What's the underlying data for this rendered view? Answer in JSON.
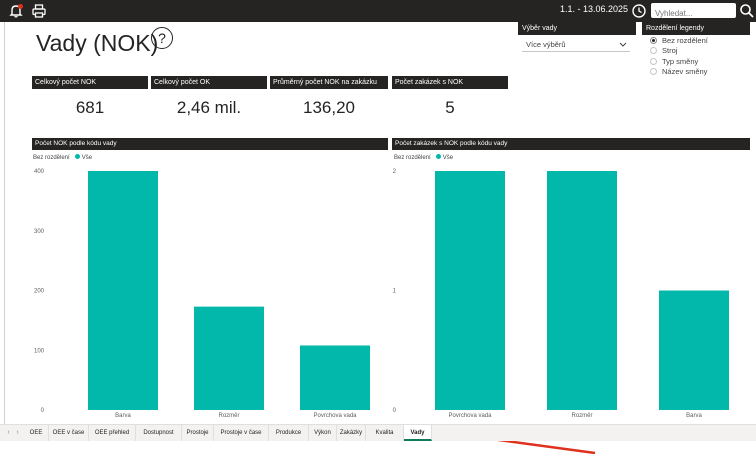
{
  "topbar": {
    "date_range": "1.1. - 13.06.2025",
    "search_placeholder": "Vyhledat..."
  },
  "page": {
    "title": "Vady (NOK)",
    "help_glyph": "?"
  },
  "slicer_defect": {
    "title": "Výběr vady",
    "selected": "Více výběrů"
  },
  "slicer_legend": {
    "title": "Rozdělení legendy",
    "options": [
      "Bez rozdělení",
      "Stroj",
      "Typ směny",
      "Název směny"
    ],
    "selected_index": 0
  },
  "cards": [
    {
      "title": "Celkový počet NOK",
      "value": "681"
    },
    {
      "title": "Celkový počet OK",
      "value": "2,46 mil."
    },
    {
      "title": "Průměrný počet NOK na zakázku",
      "value": "136,20"
    },
    {
      "title": "Počet zakázek s NOK",
      "value": "5"
    }
  ],
  "colors": {
    "bar": "#01b8aa",
    "header": "#252423",
    "arrow": "#e0301e"
  },
  "chart_data": [
    {
      "type": "bar",
      "title": "Počet NOK podle kódu vady",
      "legend_title": "Bez rozdělení",
      "legend_entry": "Vše",
      "categories": [
        "Barva",
        "Rozměr",
        "Povrchova vada"
      ],
      "values": [
        400,
        173,
        108
      ],
      "ylim": [
        0,
        400
      ],
      "yticks": [
        0,
        100,
        200,
        300,
        400
      ]
    },
    {
      "type": "bar",
      "title": "Počet zakázek s NOK podle kódu vady",
      "legend_title": "Bez rozdělení",
      "legend_entry": "Vše",
      "categories": [
        "Povrchova vada",
        "Rozměr",
        "Barva"
      ],
      "values": [
        2,
        2,
        1
      ],
      "ylim": [
        0,
        2
      ],
      "yticks": [
        0,
        1,
        2
      ]
    }
  ],
  "tabs": {
    "items": [
      "OEE",
      "OEE v čase",
      "OEE přehled",
      "Dostupnost",
      "Prostoje",
      "Prostoje v čase",
      "Produkce",
      "Výkon",
      "Zakázky",
      "Kvalita",
      "Vady"
    ],
    "active_index": 10,
    "prev_glyph": "‹",
    "next_glyph": "›"
  }
}
